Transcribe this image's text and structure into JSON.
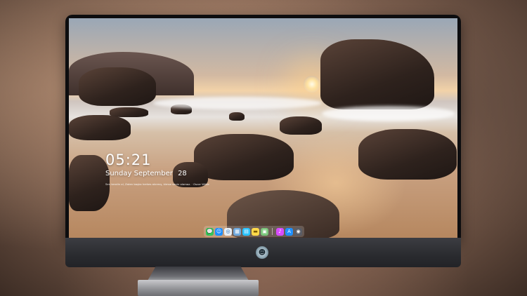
{
  "lock_screen": {
    "time": "05:21",
    "weekday_month": "Sunday September",
    "day": "28",
    "quote": "Sen kendin ol, Zaten başka herkes alınmış, kimse senin olamaz. · Oscar Wilde"
  },
  "dock": {
    "apps": [
      {
        "name": "messages",
        "icon": "💬",
        "color": "#34c759"
      },
      {
        "name": "finder",
        "icon": "☺",
        "color": "#1f8fff"
      },
      {
        "name": "safari",
        "icon": "◎",
        "color": "#e9eef3"
      },
      {
        "name": "preview",
        "icon": "▦",
        "color": "#6fa8dc"
      },
      {
        "name": "claquette",
        "icon": "▤",
        "color": "#2ac3ff"
      },
      {
        "name": "notes",
        "icon": "▬",
        "color": "#ffd84a"
      },
      {
        "name": "photos",
        "icon": "▣",
        "color": "#7bc67b"
      },
      {
        "name": "itunes",
        "icon": "♪",
        "color": "#d84cff"
      },
      {
        "name": "app-store",
        "icon": "A",
        "color": "#1e90ff"
      },
      {
        "name": "screenshot",
        "icon": "◉",
        "color": "#5a5d66"
      }
    ]
  },
  "brand": {
    "logo_icon": "alien-icon"
  }
}
